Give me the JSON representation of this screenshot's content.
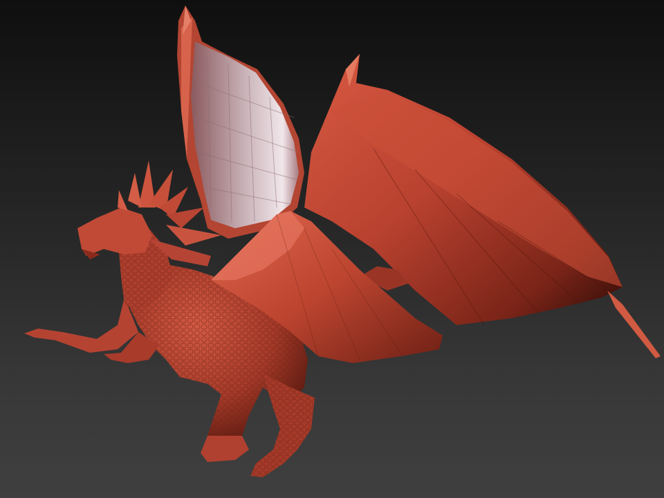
{
  "viewport": {
    "background_top": "#0f0f0f",
    "background_bottom": "#3f3f3f"
  },
  "model": {
    "subject": "dragon-sculpt",
    "base_color": "#b8412f",
    "highlight_color": "#e0674e",
    "shadow_color": "#3a1008",
    "membrane_color": "#c9b3b8",
    "membrane_highlight": "#f0e6ea"
  }
}
